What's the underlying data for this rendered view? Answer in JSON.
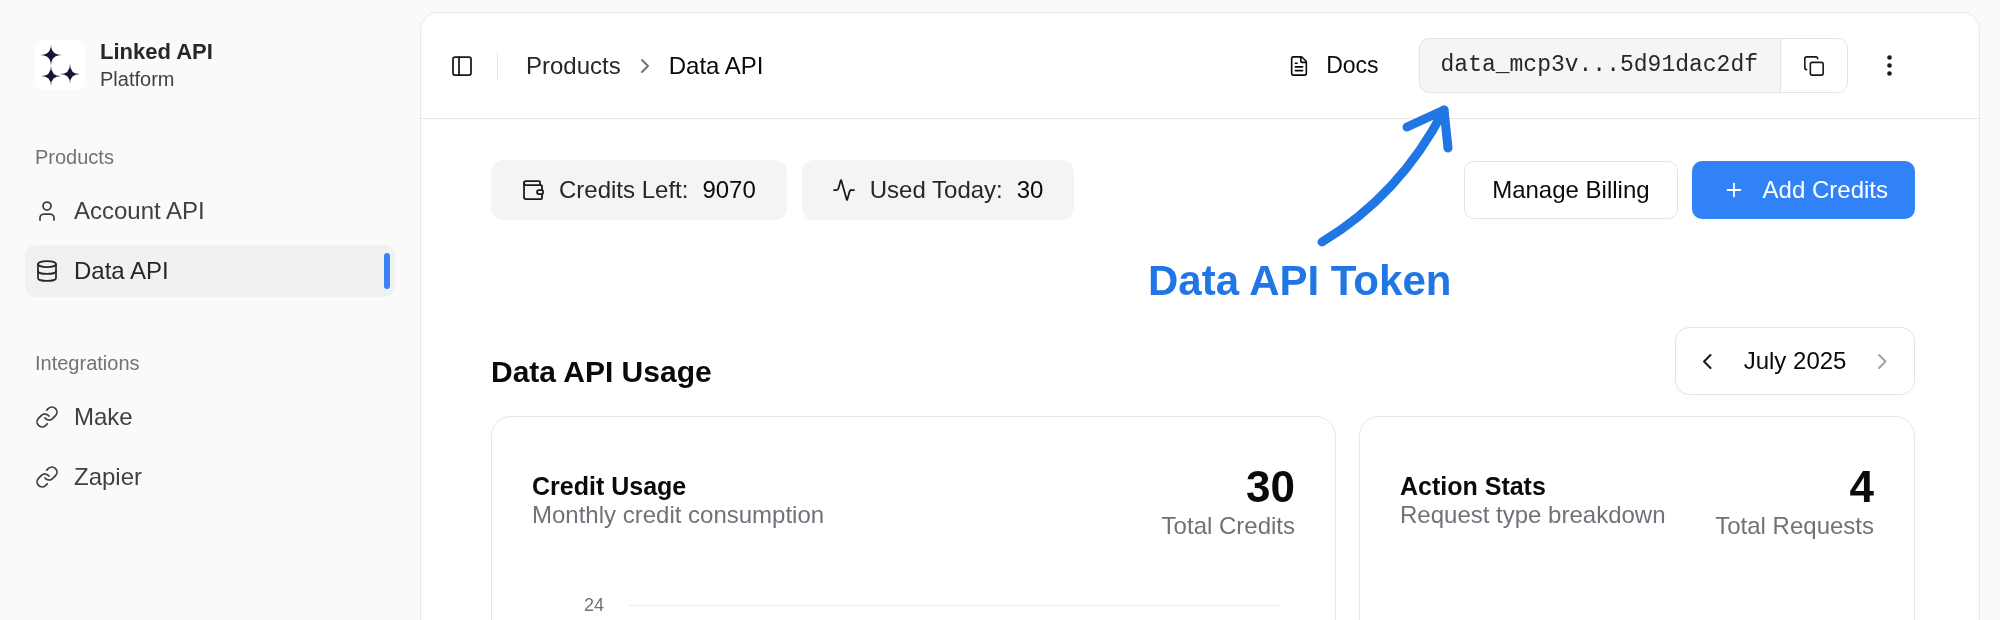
{
  "sidebar": {
    "brand": {
      "name": "Linked API",
      "subtitle": "Platform"
    },
    "sections": [
      {
        "title": "Products",
        "items": [
          {
            "kind": "account",
            "label": "Account API",
            "selected": false
          },
          {
            "kind": "dataset",
            "label": "Data API",
            "selected": true
          }
        ]
      },
      {
        "title": "Integrations",
        "items": [
          {
            "kind": "integration",
            "label": "Make",
            "selected": false
          },
          {
            "kind": "integration",
            "label": "Zapier",
            "selected": false
          }
        ]
      }
    ]
  },
  "header": {
    "breadcrumbs": [
      "Products",
      "Data API"
    ],
    "docs_link": "Docs",
    "api_token": "data_mcp3v...5d91dac2df"
  },
  "stats": [
    {
      "kind": "balance",
      "label": "Credits Left:",
      "value": "9070"
    },
    {
      "kind": "usage",
      "label": "Used Today:",
      "value": "30"
    }
  ],
  "actions": [
    {
      "kind": "secondary",
      "label": "Manage Billing"
    },
    {
      "kind": "primary",
      "label": "Add Credits"
    }
  ],
  "annotation": {
    "text": "Data API Token"
  },
  "usage": {
    "title": "Data API Usage",
    "month_picker": {
      "label": "July 2025",
      "prev": {
        "disabled": false
      },
      "next": {
        "disabled": true
      }
    },
    "cards": [
      {
        "title": "Credit Usage",
        "subtitle": "Monthly credit consumption",
        "total": "30",
        "total_label": "Total Credits",
        "chart": {
          "y_tick_labels": [
            "24"
          ]
        }
      },
      {
        "title": "Action Stats",
        "subtitle": "Request type breakdown",
        "total": "4",
        "total_label": "Total Requests"
      }
    ]
  }
}
